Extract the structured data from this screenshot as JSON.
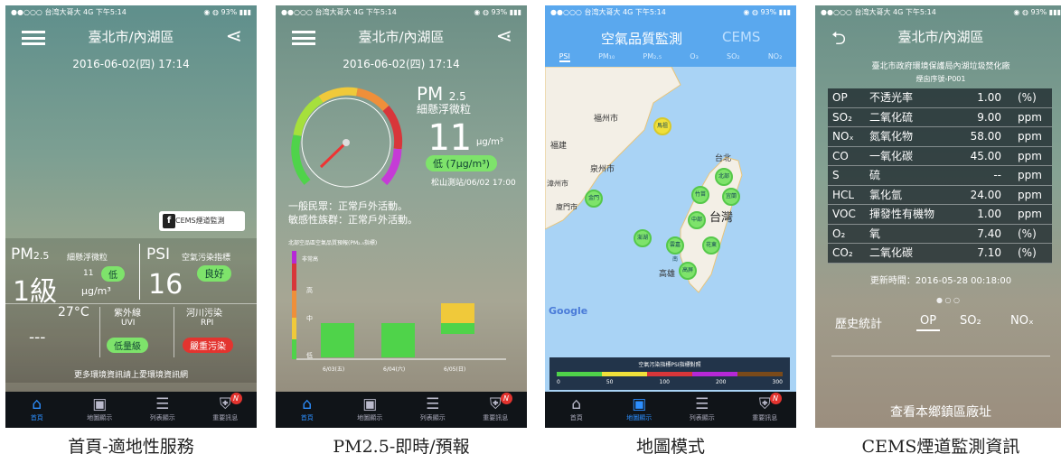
{
  "status": {
    "carrier": "●●○○○ 台湾大哥大  4G  下午5:14",
    "battery": "◉ ◍ 93% ▮▮▮"
  },
  "colors": {
    "good": "#7ee36b",
    "bad": "#e3342f",
    "accent": "#2d8fff"
  },
  "tabs": [
    {
      "icon": "house-icon",
      "label": "首頁"
    },
    {
      "icon": "map-icon",
      "label": "地圖顯示"
    },
    {
      "icon": "list-icon",
      "label": "列表顯示"
    },
    {
      "icon": "alert-shield-icon",
      "label": "重要訊息",
      "badge": "N"
    }
  ],
  "screen1": {
    "city": "臺北市/內湖區",
    "date": "2016-06-02(四) 17:14",
    "cems_button": "CEMS煙道監測",
    "pm_label": "PM",
    "pm_sub": "2.5",
    "pm_desc": "細懸浮微粒",
    "pm_level": "1級",
    "pm_value": "11",
    "pm_badge": "低",
    "pm_unit": "μg/m³",
    "psi_label": "PSI",
    "psi_desc": "空氣污染指標",
    "psi_badge": "良好",
    "psi_value": "16",
    "temp": "27°C",
    "temp_sub": "---",
    "uvi_title": "紫外線",
    "uvi_sub": "UVI",
    "uvi_badge": "低量級",
    "rpi_title": "河川污染",
    "rpi_sub": "RPI",
    "rpi_badge": "嚴重污染",
    "more": "更多環境資訊請上愛環境資訊網"
  },
  "screen2": {
    "city": "臺北市/內湖區",
    "date": "2016-06-02(四) 17:14",
    "pm_label": "PM",
    "pm_sub": "2.5",
    "pm_desc": "細懸浮微粒",
    "value": "11",
    "unit": "μg/m³",
    "badge": "低 (7μg/m³)",
    "station": "松山測站/06/02 17:00",
    "advice1": "一般民眾：正常戶外活動。",
    "advice2": "敏感性族群：正常戶外活動。",
    "chart_title": "北部空品區空氣品質預報(PM₂.₅指標)",
    "scale_top": "非常高",
    "scale_high": "高",
    "scale_mid": "中",
    "scale_low": "低",
    "days": [
      "6/03(五)",
      "6/04(六)",
      "6/05(日)"
    ]
  },
  "screen3": {
    "tab_air": "空氣品質監測",
    "tab_cems": "CEMS",
    "subtabs": [
      "PSI",
      "PM₁₀",
      "PM₂.₅",
      "O₃",
      "SO₂",
      "NO₂"
    ],
    "places": [
      "福州市",
      "福建",
      "泉州市",
      "漳州市",
      "廈門市",
      "台北",
      "台灣",
      "高雄"
    ],
    "map_brand": "Google",
    "legend_title": "空氣污染指標PSI指標對照",
    "legend_ticks": [
      "0",
      "50",
      "100",
      "200",
      "300"
    ],
    "clusters": [
      "馬祖",
      "金門",
      "澎湖",
      "北部",
      "竹苗",
      "中部",
      "雲嘉南",
      "高屏",
      "宜蘭",
      "花東"
    ]
  },
  "screen4": {
    "city": "臺北市/內湖區",
    "org": "臺北市政府環境保護局內湖垃圾焚化廠",
    "stack": "煙囪序號-P001",
    "rows": [
      [
        "OP",
        "不透光率",
        "1.00",
        "(%)"
      ],
      [
        "SO₂",
        "二氧化硫",
        "9.00",
        "ppm"
      ],
      [
        "NOₓ",
        "氮氧化物",
        "58.00",
        "ppm"
      ],
      [
        "CO",
        "一氧化碳",
        "45.00",
        "ppm"
      ],
      [
        "S",
        "硫",
        "--",
        "ppm"
      ],
      [
        "HCL",
        "氯化氫",
        "24.00",
        "ppm"
      ],
      [
        "VOC",
        "揮發性有機物",
        "1.00",
        "ppm"
      ],
      [
        "O₂",
        "氧",
        "7.40",
        "(%)"
      ],
      [
        "CO₂",
        "二氧化碳",
        "7.10",
        "(%)"
      ]
    ],
    "updated": "更新時間：2016-05-28 00:18:00",
    "hist": "歷史統計",
    "hist_tabs": [
      "OP",
      "SO₂",
      "NOₓ"
    ],
    "footer": "查看本鄉鎮區廠址"
  },
  "captions": [
    "首頁-適地性服務",
    "PM2.5-即時/預報",
    "地圖模式",
    "CEMS煙道監測資訊"
  ]
}
